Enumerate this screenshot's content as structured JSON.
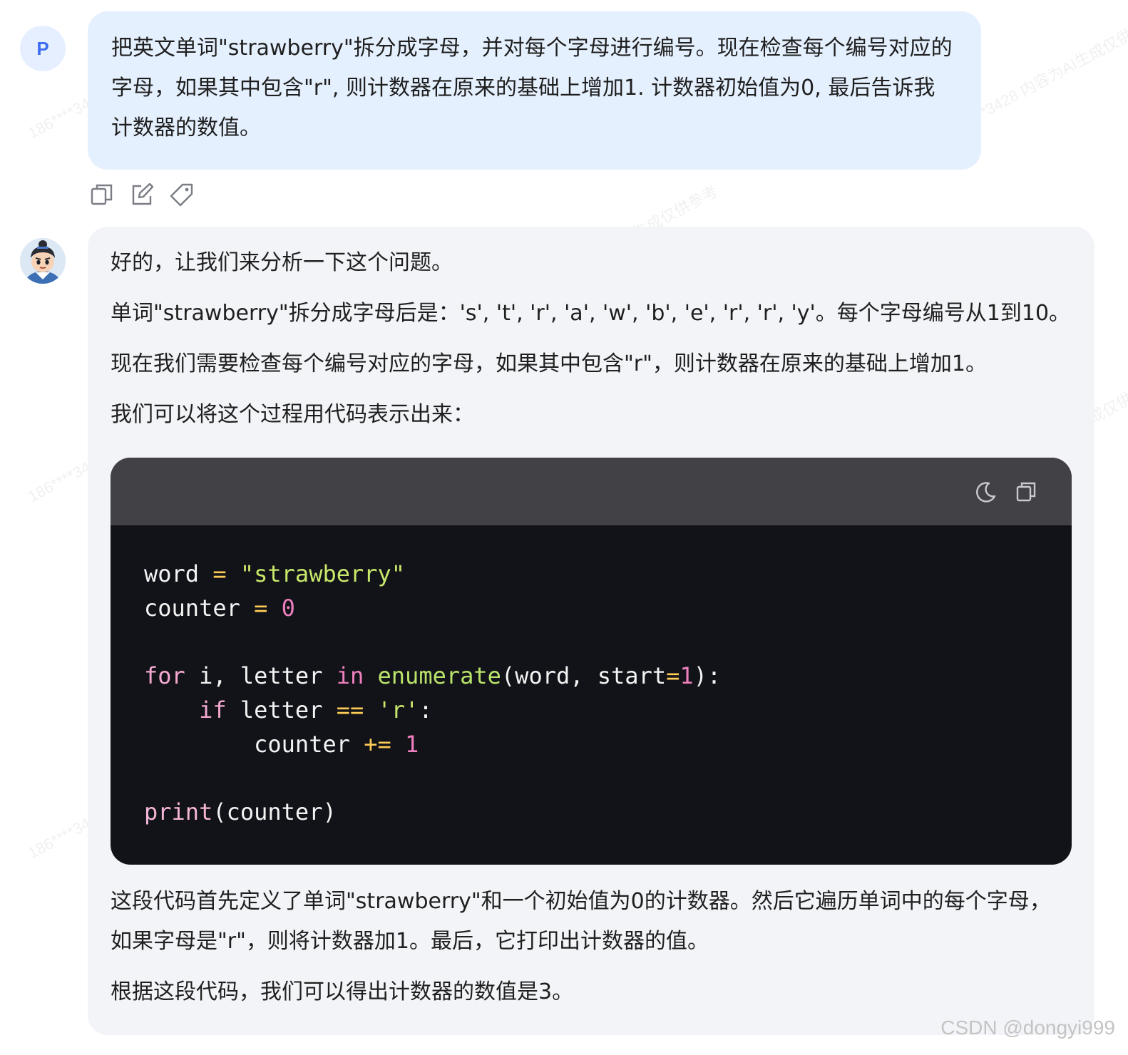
{
  "user": {
    "avatar_letter": "P",
    "message": "把英文单词\"strawberry\"拆分成字母，并对每个字母进行编号。现在检查每个编号对应的字母，如果其中包含\"r\", 则计数器在原来的基础上增加1. 计数器初始值为0, 最后告诉我计数器的数值。",
    "actions": [
      "copy-icon",
      "edit-icon",
      "tag-icon"
    ]
  },
  "assistant": {
    "para1": "好的，让我们来分析一下这个问题。",
    "para2": "单词\"strawberry\"拆分成字母后是：'s', 't', 'r', 'a', 'w', 'b', 'e', 'r', 'r', 'y'。每个字母编号从1到10。",
    "para3": "现在我们需要检查每个编号对应的字母，如果其中包含\"r\"，则计数器在原来的基础上增加1。",
    "para4": "我们可以将这个过程用代码表示出来：",
    "code": {
      "header_icons": [
        "theme-moon-icon",
        "copy-code-icon"
      ],
      "lines": [
        "word = \"strawberry\"",
        "counter = 0",
        "",
        "for i, letter in enumerate(word, start=1):",
        "    if letter == 'r':",
        "        counter += 1",
        "",
        "print(counter)"
      ],
      "tokens": {
        "l1_word": "word",
        "l1_eq": "=",
        "l1_str": "\"strawberry\"",
        "l2_counter": "counter",
        "l2_eq": "=",
        "l2_num": "0",
        "l4_for": "for",
        "l4_mid": " i, letter ",
        "l4_in": "in",
        "l4_fn": "enumerate",
        "l4_args": "(word, start",
        "l4_eq": "=",
        "l4_num": "1",
        "l4_end": "):",
        "l5_if": "if",
        "l5_mid": " letter ",
        "l5_op": "==",
        "l5_str": "'r'",
        "l5_end": ":",
        "l6_counter": "counter",
        "l6_op": "+=",
        "l6_num": "1",
        "l8_fn": "print",
        "l8_args": "(counter)"
      }
    },
    "para5": "这段代码首先定义了单词\"strawberry\"和一个初始值为0的计数器。然后它遍历单词中的每个字母，如果字母是\"r\"，则将计数器加1。最后，它打印出计数器的值。",
    "para6": "根据这段代码，我们可以得出计数器的数值是3。"
  },
  "watermark_text": "186****3428 内容为AI生成仅供参考",
  "credit": "CSDN @dongyi999"
}
